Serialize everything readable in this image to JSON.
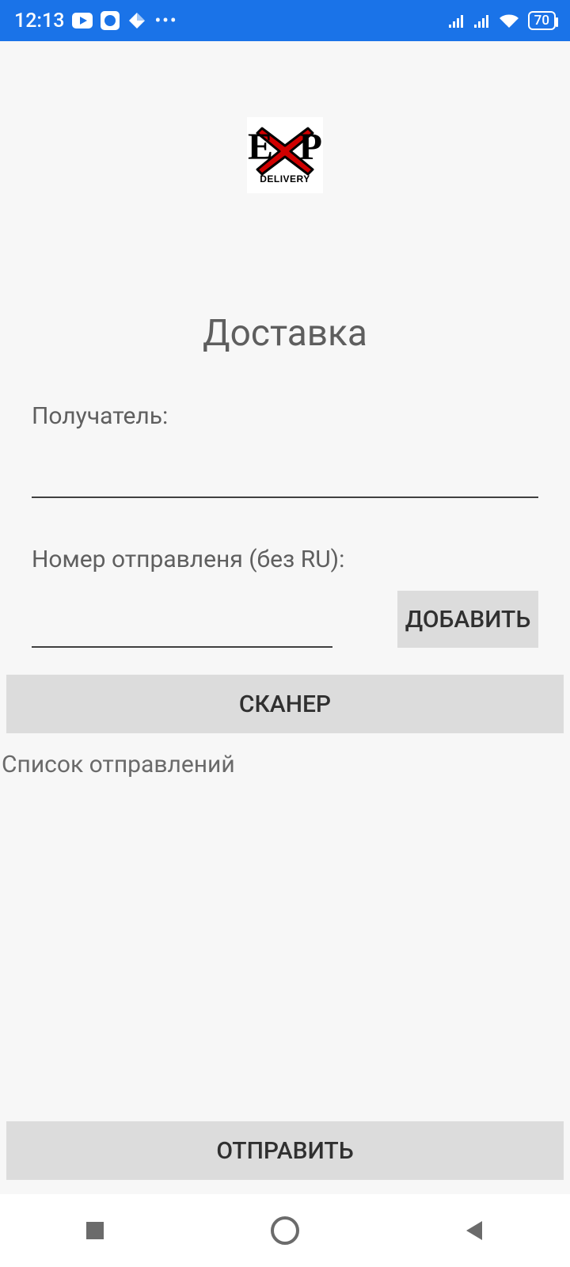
{
  "status": {
    "time": "12:13",
    "battery": "70"
  },
  "logo": {
    "left_letter": "E",
    "right_letter": "P",
    "bottom_text": "DELIVERY"
  },
  "page": {
    "title": "Доставка"
  },
  "form": {
    "recipient_label": "Получатель:",
    "recipient_value": "",
    "shipment_label": "Номер отправленя (без RU):",
    "shipment_value": "",
    "add_button": "ДОБАВИТЬ",
    "scanner_button": "СКАНЕР",
    "list_heading": "Список отправлений",
    "send_button": "ОТПРАВИТЬ"
  }
}
